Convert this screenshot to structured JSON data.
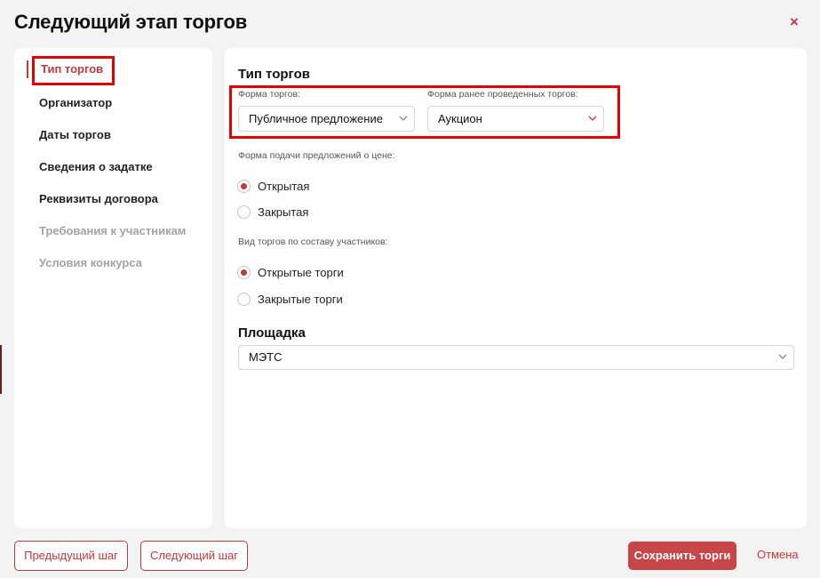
{
  "modal": {
    "title": "Следующий этап торгов",
    "close_symbol": "×"
  },
  "sidebar": {
    "items": [
      {
        "label": "Тип торгов",
        "state": "active"
      },
      {
        "label": "Организатор",
        "state": "enabled"
      },
      {
        "label": "Даты торгов",
        "state": "enabled"
      },
      {
        "label": "Сведения о задатке",
        "state": "enabled"
      },
      {
        "label": "Реквизиты договора",
        "state": "enabled"
      },
      {
        "label": "Требования к участникам",
        "state": "disabled"
      },
      {
        "label": "Условия конкурса",
        "state": "disabled"
      }
    ]
  },
  "content": {
    "section_type": {
      "title": "Тип торгов",
      "form_label": "Форма торгов:",
      "form_value": "Публичное предложение",
      "prev_form_label": "Форма ранее проведенных торгов:",
      "prev_form_value": "Аукцион",
      "price_label": "Форма подачи предложений о цене:",
      "price_options": [
        {
          "label": "Открытая",
          "checked": true
        },
        {
          "label": "Закрытая",
          "checked": false
        }
      ],
      "participants_label": "Вид торгов по составу участников:",
      "participants_options": [
        {
          "label": "Открытые торги",
          "checked": true
        },
        {
          "label": "Закрытые торги",
          "checked": false
        }
      ]
    },
    "section_platform": {
      "title": "Площадка",
      "value": "МЭТС"
    }
  },
  "footer": {
    "prev_label": "Предыдущий шаг",
    "next_label": "Следующий шаг",
    "save_label": "Сохранить торги",
    "cancel_label": "Отмена"
  },
  "colors": {
    "accent": "#c0393b",
    "highlight_box": "#e10000",
    "primary_button": "#c84548",
    "background": "#f3f3f3"
  },
  "icons": {
    "close": "close-icon",
    "select_arrow": "chevron-down-icon"
  }
}
